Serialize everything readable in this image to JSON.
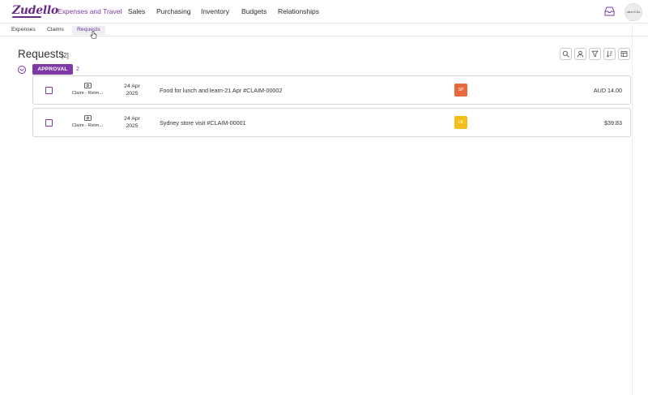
{
  "app": {
    "logo": "Zudello"
  },
  "topnav": {
    "items": [
      "Expenses and Travel",
      "Sales",
      "Purchasing",
      "Inventory",
      "Budgets",
      "Relationships"
    ],
    "active_index": 0,
    "avatar_text": "Jane B Do"
  },
  "subnav": {
    "tabs": [
      "Expenses",
      "Claims",
      "Requests"
    ],
    "active_index": 2
  },
  "header": {
    "title": "Requests",
    "count": "[2]"
  },
  "toolbar": {
    "icons": [
      "search-icon",
      "user-icon",
      "filter-icon",
      "sort-icon",
      "columns-icon"
    ]
  },
  "group": {
    "label": "APPROVAL",
    "count": "2"
  },
  "rows": [
    {
      "type": "Claim - Reim...",
      "date_line1": "24 Apr",
      "date_line2": "2025",
      "description": "Food for lunch and learn-21 Apr #CLAIM-00002",
      "tag": "SP",
      "tag_color": "#e8582a",
      "amount": "AUD 14.00"
    },
    {
      "type": "Claim - Reim...",
      "date_line1": "24 Apr",
      "date_line2": "2025",
      "description": "Sydney store visit #CLAIM-00001",
      "tag": "LK",
      "tag_color": "#f5b800",
      "amount": "$39.83"
    }
  ],
  "colors": {
    "brand": "#7d3aa6",
    "border": "#d6d6dc"
  }
}
